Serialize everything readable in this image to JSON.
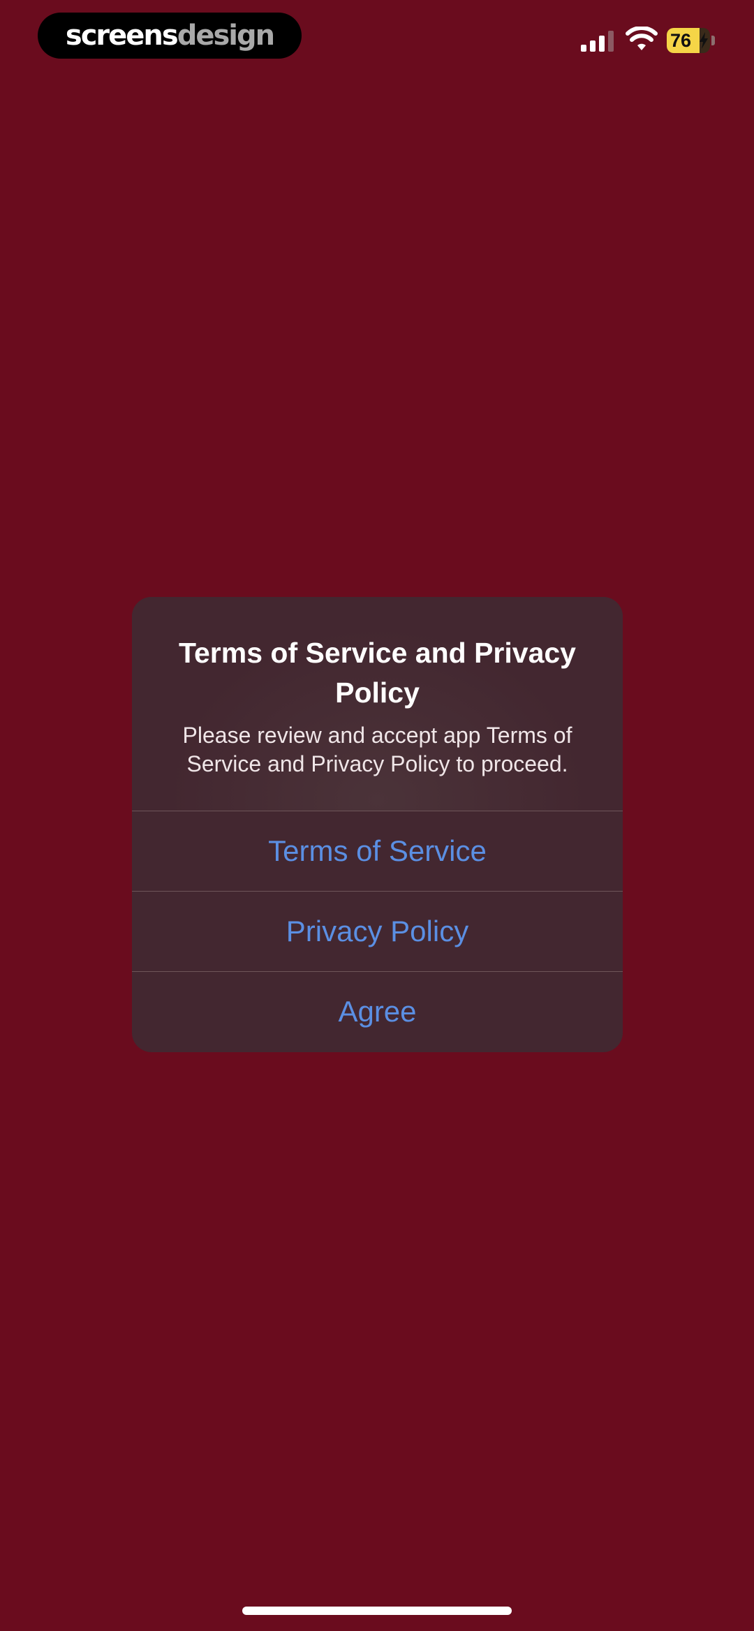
{
  "status_bar": {
    "brand_part1": "screens",
    "brand_part2": "design",
    "battery_level": "76",
    "battery_percent": 76,
    "signal_icon": "cellular-signal-icon",
    "wifi_icon": "wifi-icon",
    "charging_icon": "bolt-icon"
  },
  "dialog": {
    "title": "Terms of Service and Privacy Policy",
    "message": "Please review and accept app Terms of Service and Privacy Policy to proceed.",
    "buttons": [
      {
        "label": "Terms of Service"
      },
      {
        "label": "Privacy Policy"
      },
      {
        "label": "Agree"
      }
    ]
  },
  "colors": {
    "background": "#6a0c1e",
    "dialog_bg": "#432730",
    "button_text": "#5b8fe3",
    "battery_fill": "#f5d547"
  }
}
